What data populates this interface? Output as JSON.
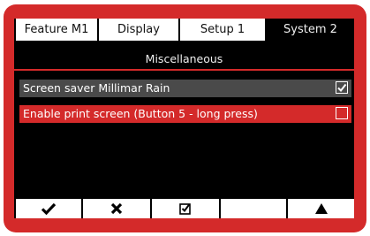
{
  "tabs": [
    {
      "label": "Feature  M1",
      "active": false
    },
    {
      "label": "Display",
      "active": false
    },
    {
      "label": "Setup 1",
      "active": false
    },
    {
      "label": "System 2",
      "active": true
    }
  ],
  "section_title": "Miscellaneous",
  "settings": [
    {
      "label": "Screen saver Millimar Rain",
      "checked": true
    },
    {
      "label": "Enable print screen (Button 5 - long press)",
      "checked": false
    }
  ],
  "softkeys": [
    {
      "icon": "checkmark-icon"
    },
    {
      "icon": "x-icon"
    },
    {
      "icon": "checkbox-checked-icon"
    },
    {
      "icon": ""
    },
    {
      "icon": "triangle-up-icon"
    }
  ],
  "colors": {
    "frame": "#d42a2a",
    "screen_background": "#000000",
    "row_normal": "#4a4a4a",
    "row_selected": "#d42a2a",
    "tab_background": "#ffffff"
  }
}
